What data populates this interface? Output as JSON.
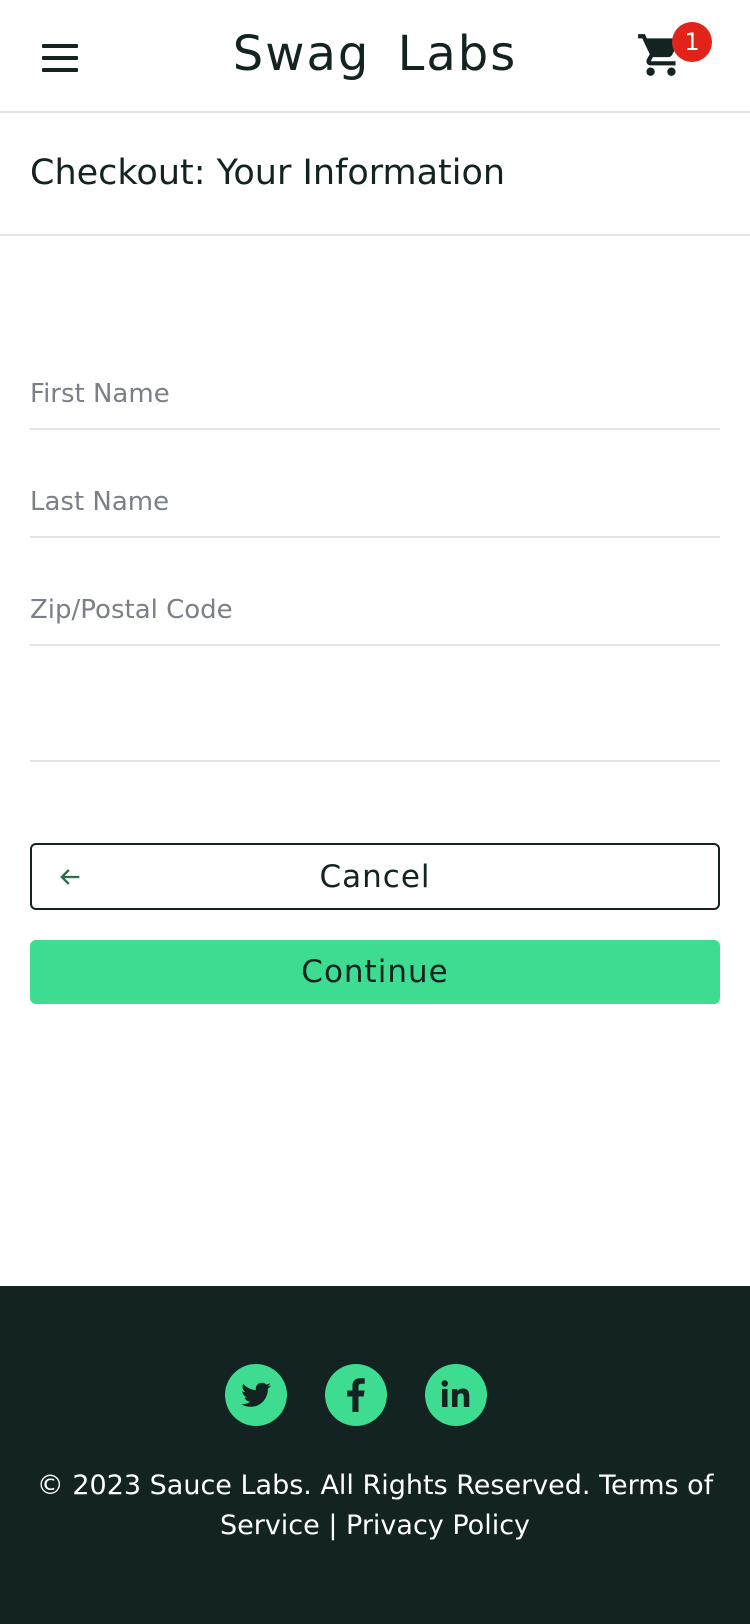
{
  "header": {
    "app_title": "Swag Labs",
    "cart_count": "1",
    "menu_icon": "hamburger-menu-icon",
    "cart_icon": "shopping-cart-icon"
  },
  "page": {
    "title": "Checkout: Your Information"
  },
  "form": {
    "first_name_placeholder": "First Name",
    "last_name_placeholder": "Last Name",
    "zip_placeholder": "Zip/Postal Code",
    "first_name_value": "",
    "last_name_value": "",
    "zip_value": ""
  },
  "actions": {
    "cancel_label": "Cancel",
    "cancel_icon": "arrow-left-icon",
    "continue_label": "Continue"
  },
  "footer": {
    "social": [
      "twitter-icon",
      "facebook-icon",
      "linkedin-icon"
    ],
    "copyright": "© 2023 Sauce Labs. All Rights Reserved. Terms of Service | Privacy Policy"
  },
  "colors": {
    "accent": "#3ddc91",
    "dark": "#132322",
    "badge": "#e2231a",
    "divider": "#e3e5e4"
  }
}
